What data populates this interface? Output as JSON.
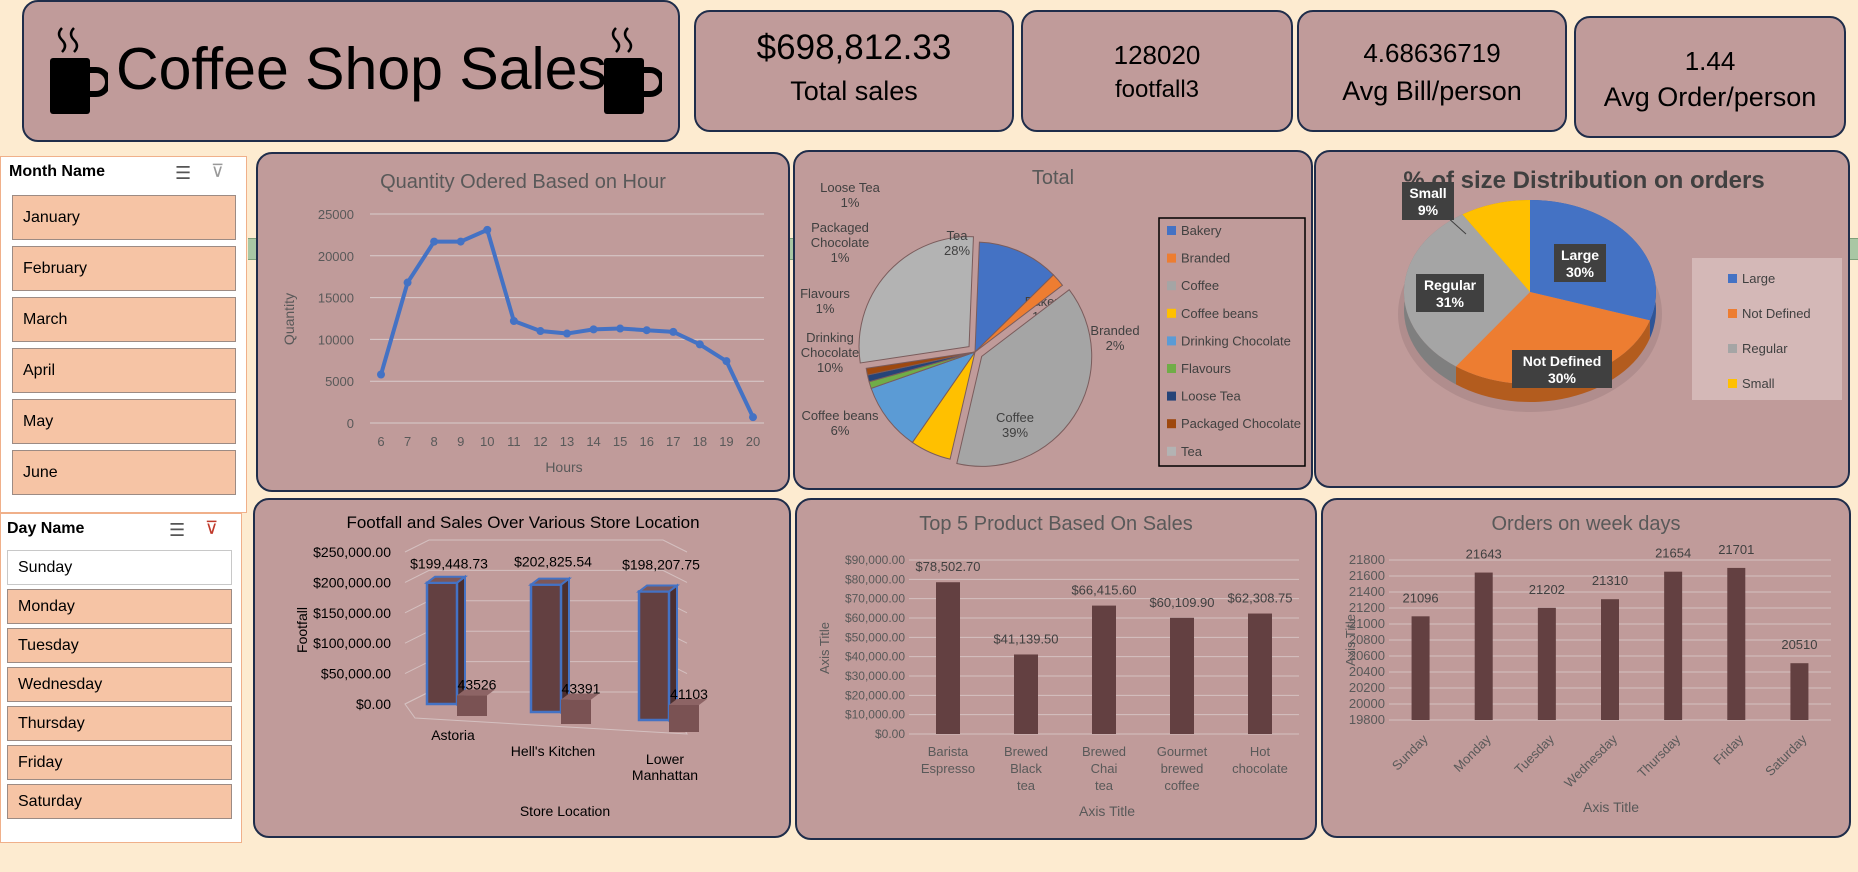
{
  "header": {
    "title": "Coffee Shop Sales"
  },
  "kpis": {
    "total_sales_value": "$698,812.33",
    "total_sales_label": "Total sales",
    "footfall_value": "128020",
    "footfall_label": "footfall3",
    "avg_bill_value": "4.68636719",
    "avg_bill_label": "Avg Bill/person",
    "avg_order_value": "1.44",
    "avg_order_label": "Avg Order/person"
  },
  "month_slicer": {
    "title": "Month Name",
    "items": [
      "January",
      "February",
      "March",
      "April",
      "May",
      "June"
    ]
  },
  "day_slicer": {
    "title": "Day Name",
    "items": [
      "Sunday",
      "Monday",
      "Tuesday",
      "Wednesday",
      "Thursday",
      "Friday",
      "Saturday"
    ],
    "selected": "Sunday"
  },
  "colors": {
    "panel": "#c09b9a",
    "bar": "#634041",
    "line": "#4472c4",
    "background": "#fdebd0"
  },
  "chart_data": [
    {
      "id": "hourly",
      "type": "line",
      "title": "Quantity Odered Based on Hour",
      "xlabel": "Hours",
      "ylabel": "Quantity",
      "x": [
        6,
        7,
        8,
        9,
        10,
        11,
        12,
        13,
        14,
        15,
        16,
        17,
        18,
        19,
        20
      ],
      "values": [
        5800,
        16800,
        21700,
        21700,
        23100,
        12200,
        11000,
        10700,
        11200,
        11300,
        11100,
        10900,
        9400,
        7400,
        700
      ],
      "yticks": [
        0,
        5000,
        10000,
        15000,
        20000,
        25000
      ],
      "ylim": [
        0,
        25000
      ]
    },
    {
      "id": "category",
      "type": "pie",
      "title": "Total",
      "slices": [
        {
          "name": "Bakery",
          "label": "Bakery",
          "pct_label": "12%",
          "value": 12,
          "color": "#4472c4"
        },
        {
          "name": "Branded",
          "label": "Branded",
          "pct_label": "2%",
          "value": 2,
          "color": "#ed7d31"
        },
        {
          "name": "Coffee",
          "label": "Coffee",
          "pct_label": "39%",
          "value": 39,
          "color": "#a5a5a5"
        },
        {
          "name": "Coffee beans",
          "label": "Coffee beans",
          "pct_label": "6%",
          "value": 6,
          "color": "#ffc000"
        },
        {
          "name": "Drinking Chocolate",
          "label": "Drinking Chocolate",
          "pct_label": "10%",
          "value": 10,
          "color": "#5b9bd5"
        },
        {
          "name": "Flavours",
          "label": "Flavours",
          "pct_label": "1%",
          "value": 1,
          "color": "#70ad47"
        },
        {
          "name": "Loose Tea",
          "label": "Loose Tea",
          "pct_label": "1%",
          "value": 1,
          "color": "#264478"
        },
        {
          "name": "Packaged Chocolate",
          "label": "Packaged Chocolate",
          "pct_label": "1%",
          "value": 1,
          "color": "#9e480e"
        },
        {
          "name": "Tea",
          "label": "Tea",
          "pct_label": "28%",
          "value": 28,
          "color": "#b3b3b3"
        }
      ],
      "legend": [
        "Bakery",
        "Branded",
        "Coffee",
        "Coffee beans",
        "Drinking Chocolate",
        "Flavours",
        "Loose Tea",
        "Packaged Chocolate",
        "Tea"
      ]
    },
    {
      "id": "size",
      "type": "pie",
      "title": "%  of size Distribution on orders",
      "slices": [
        {
          "name": "Large",
          "pct_label": "30%",
          "value": 30,
          "color": "#4472c4"
        },
        {
          "name": "Not Defined",
          "pct_label": "30%",
          "value": 30,
          "color": "#ed7d31"
        },
        {
          "name": "Regular",
          "pct_label": "31%",
          "value": 31,
          "color": "#a5a5a5"
        },
        {
          "name": "Small",
          "pct_label": "9%",
          "value": 9,
          "color": "#ffc000"
        }
      ],
      "legend": [
        "Large",
        "Not Defined",
        "Regular",
        "Small"
      ]
    },
    {
      "id": "store",
      "type": "bar",
      "title": "Footfall  and Sales Over Various Store Location",
      "xlabel": "Store Location",
      "ylabel": "Footfall",
      "categories": [
        "Astoria",
        "Hell's Kitchen",
        "Lower Manhattan"
      ],
      "series": [
        {
          "name": "Sales",
          "values": [
            199448.73,
            202825.54,
            198207.75
          ],
          "labels": [
            "$199,448.73",
            "$202,825.54",
            "$198,207.75"
          ]
        },
        {
          "name": "Footfall",
          "values": [
            43526,
            43391,
            41103
          ],
          "labels": [
            "43526",
            "43391",
            "41103"
          ]
        }
      ],
      "yticks": [
        "$0.00",
        "$50,000.00",
        "$100,000.00",
        "$150,000.00",
        "$200,000.00",
        "$250,000.00"
      ],
      "ylim": [
        0,
        250000
      ]
    },
    {
      "id": "products",
      "type": "bar",
      "title": "Top 5 Product Based On Sales",
      "xlabel": "Axis Title",
      "ylabel": "Axis Title",
      "categories": [
        "Barista Espresso",
        "Brewed Black tea",
        "Brewed Chai tea",
        "Gourmet brewed coffee",
        "Hot chocolate"
      ],
      "values": [
        78502.7,
        41139.5,
        66415.6,
        60109.9,
        62308.75
      ],
      "labels": [
        "$78,502.70",
        "$41,139.50",
        "$66,415.60",
        "$60,109.90",
        "$62,308.75"
      ],
      "yticks": [
        "$0.00",
        "$10,000.00",
        "$20,000.00",
        "$30,000.00",
        "$40,000.00",
        "$50,000.00",
        "$60,000.00",
        "$70,000.00",
        "$80,000.00",
        "$90,000.00"
      ],
      "ylim": [
        0,
        90000
      ]
    },
    {
      "id": "weekdays",
      "type": "bar",
      "title": "Orders on week days",
      "xlabel": "Axis Title",
      "ylabel": "Axis Title",
      "categories": [
        "Sunday",
        "Monday",
        "Tuesday",
        "Wednesday",
        "Thursday",
        "Friday",
        "Saturday"
      ],
      "values": [
        21096,
        21643,
        21202,
        21310,
        21654,
        21701,
        20510
      ],
      "yticks": [
        19800,
        20000,
        20200,
        20400,
        20600,
        20800,
        21000,
        21200,
        21400,
        21600,
        21800
      ],
      "ylim": [
        19800,
        21800
      ]
    }
  ]
}
